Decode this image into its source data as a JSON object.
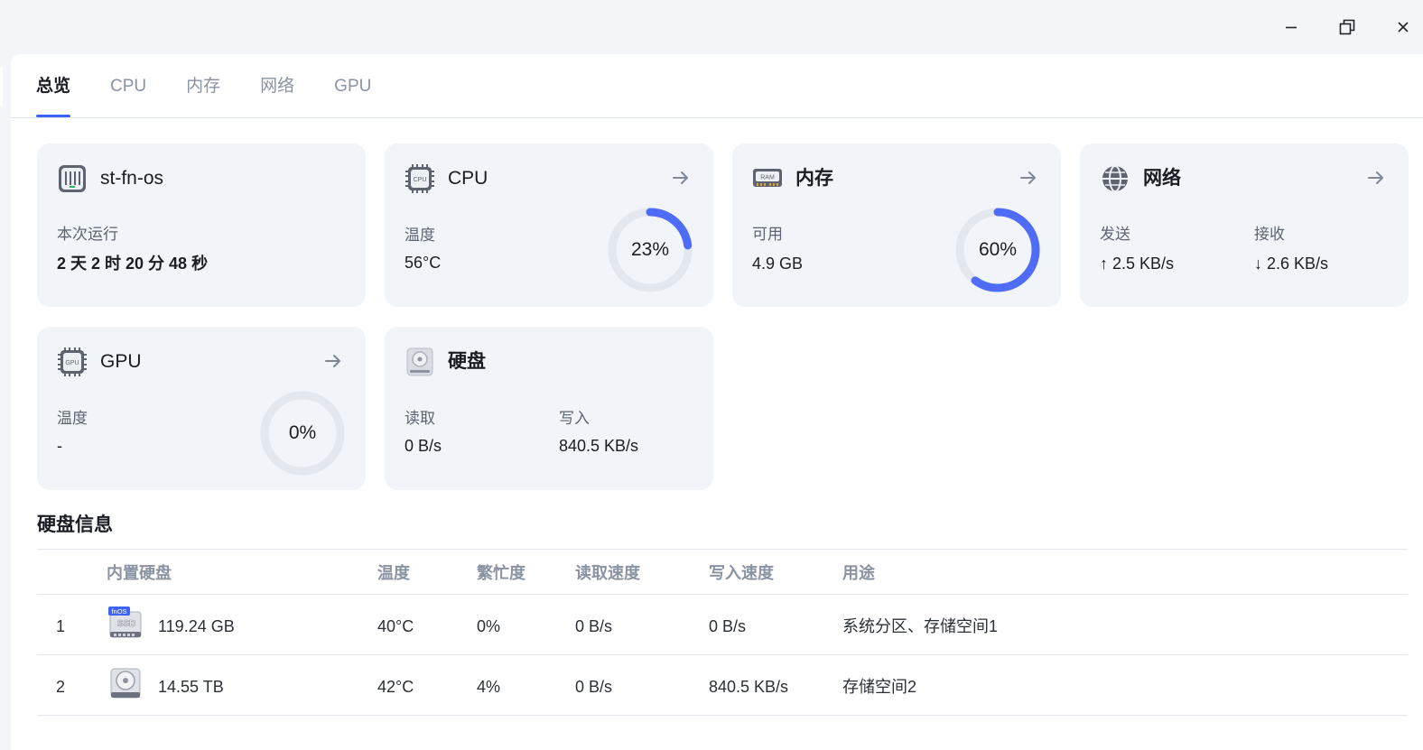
{
  "tabs": [
    "总览",
    "CPU",
    "内存",
    "网络",
    "GPU"
  ],
  "cards": {
    "host": {
      "title": "st-fn-os",
      "uptime_label": "本次运行",
      "uptime_value": "2 天 2 时 20 分 48 秒",
      "icon": "server-icon"
    },
    "cpu": {
      "title": "CPU",
      "temp_label": "温度",
      "temp_value": "56°C",
      "usage": 23,
      "usage_text": "23%",
      "icon": "cpu-chip-icon",
      "icon_text": "CPU"
    },
    "memory": {
      "title": "内存",
      "avail_label": "可用",
      "avail_value": "4.9 GB",
      "usage": 60,
      "usage_text": "60%",
      "icon": "ram-icon",
      "icon_text": "RAM"
    },
    "network": {
      "title": "网络",
      "send_label": "发送",
      "send_value": "↑ 2.5 KB/s",
      "recv_label": "接收",
      "recv_value": "↓ 2.6 KB/s",
      "icon": "globe-icon"
    },
    "gpu": {
      "title": "GPU",
      "temp_label": "温度",
      "temp_value": "-",
      "usage": 0,
      "usage_text": "0%",
      "icon": "gpu-chip-icon",
      "icon_text": "GPU"
    },
    "disk": {
      "title": "硬盘",
      "read_label": "读取",
      "read_value": "0 B/s",
      "write_label": "写入",
      "write_value": "840.5 KB/s",
      "icon": "hard-disk-icon"
    }
  },
  "disk_info": {
    "title": "硬盘信息",
    "columns": [
      "内置硬盘",
      "温度",
      "繁忙度",
      "读取速度",
      "写入速度",
      "用途"
    ],
    "rows": [
      {
        "index": "1",
        "icon": "ssd-icon",
        "ssd_brand": "fnOS",
        "ssd_label": "SSD",
        "size": "119.24 GB",
        "temp": "40°C",
        "busy": "0%",
        "read": "0 B/s",
        "write": "0 B/s",
        "usage": "系统分区、存储空间1"
      },
      {
        "index": "2",
        "icon": "hdd-icon",
        "size": "14.55 TB",
        "temp": "42°C",
        "busy": "4%",
        "read": "0 B/s",
        "write": "840.5 KB/s",
        "usage": "存储空间2"
      }
    ]
  },
  "colors": {
    "accent": "#3b63f5",
    "gauge_fill": "#4f6cf7",
    "gauge_track": "#e3e7ee",
    "card_bg": "#f1f4f9"
  }
}
